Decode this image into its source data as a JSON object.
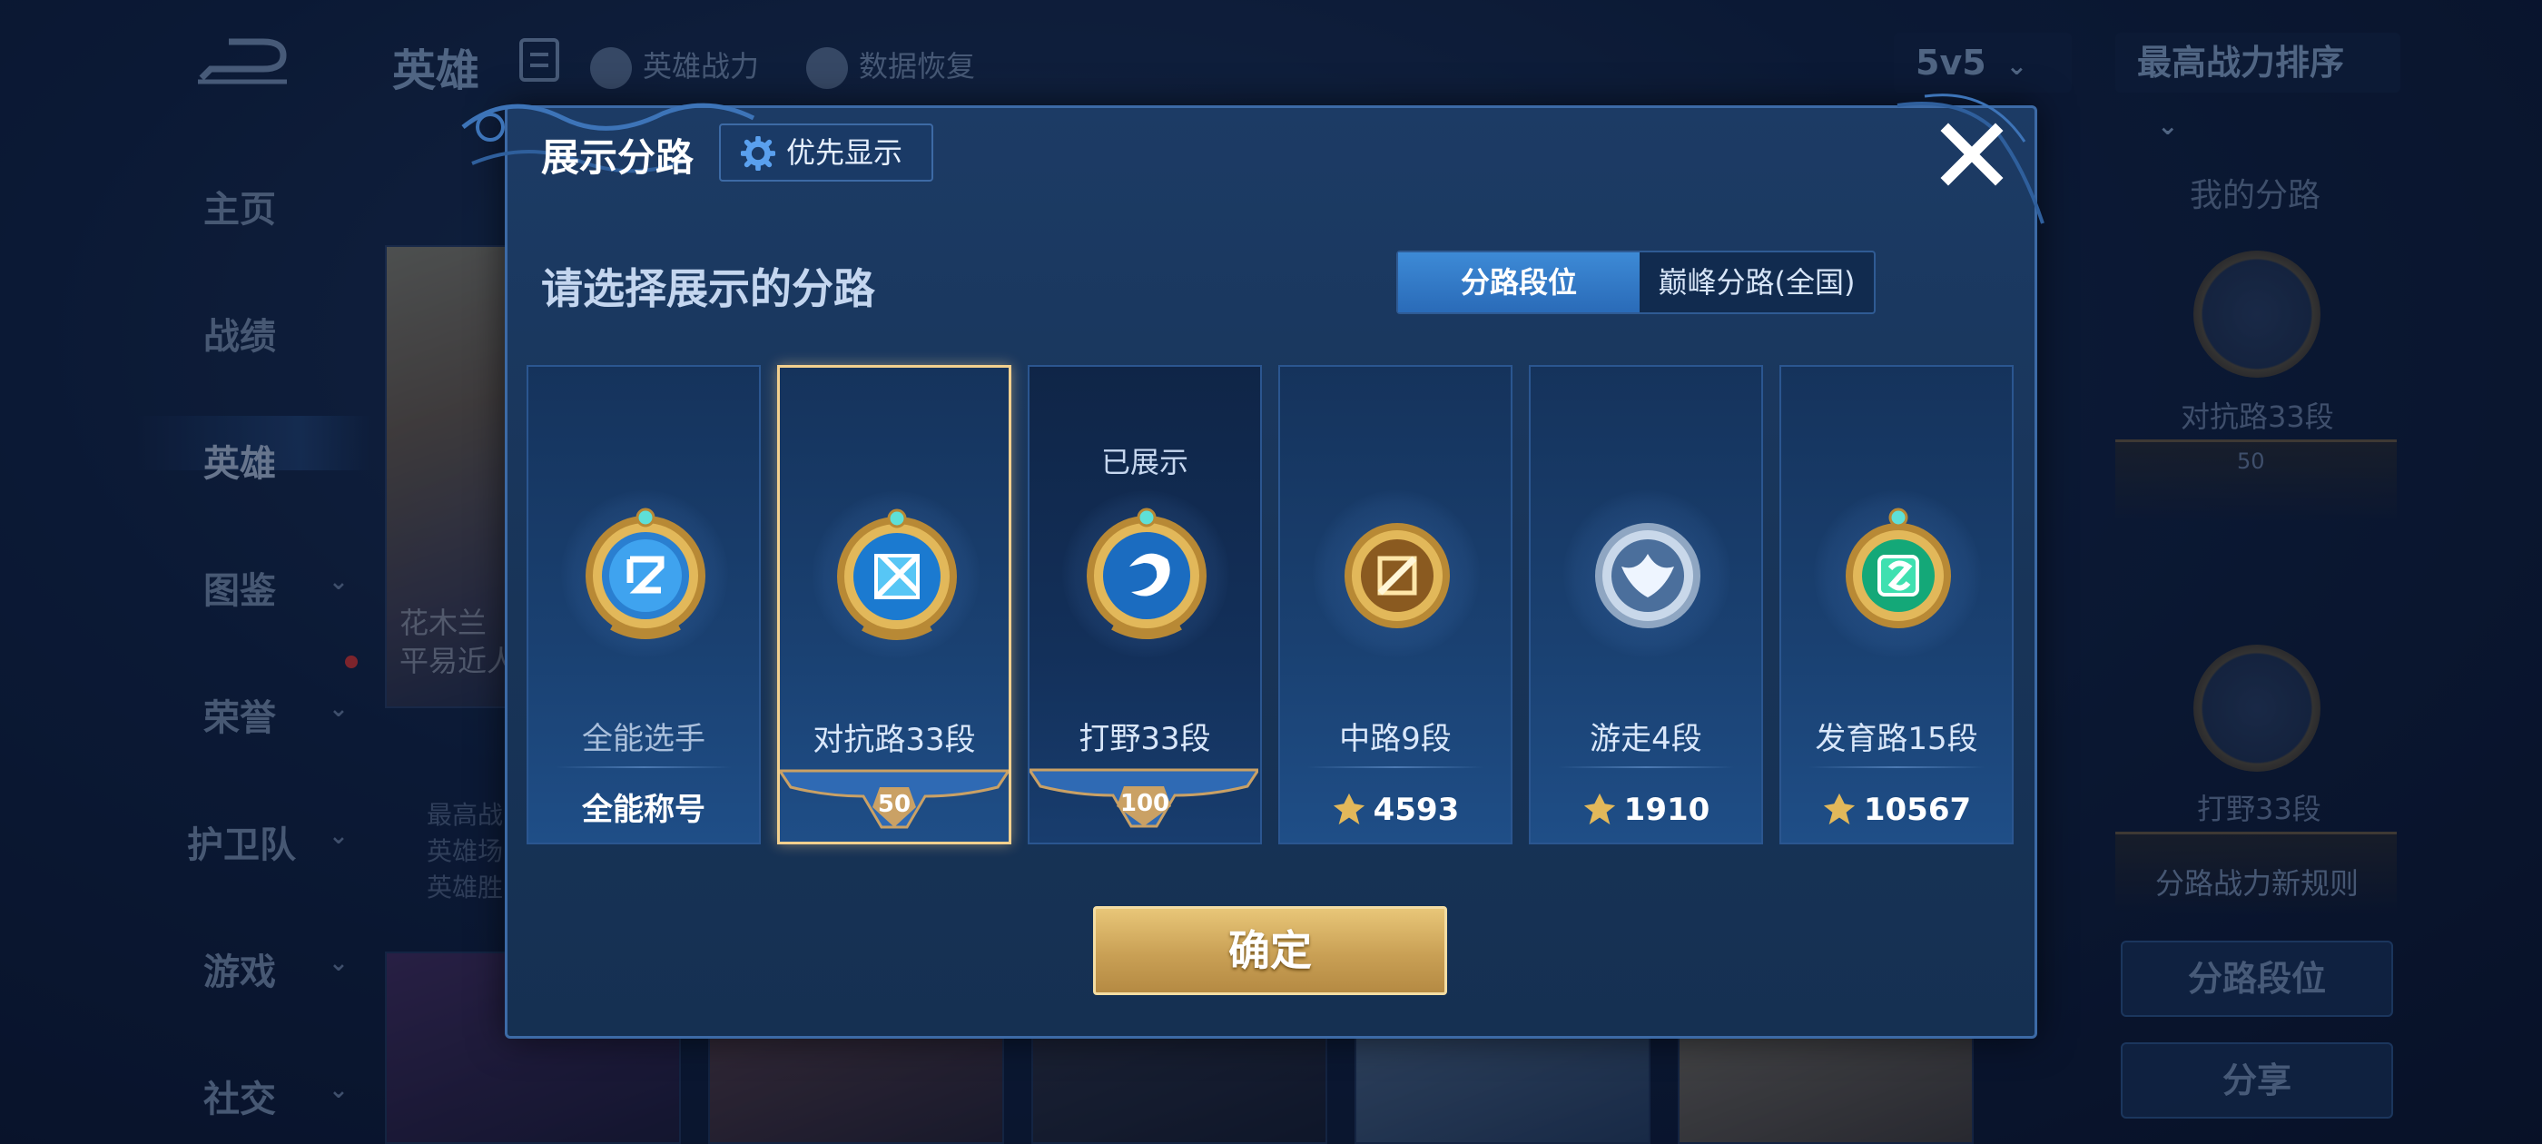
{
  "topbar": {
    "title": "英雄",
    "links": [
      "英雄战力",
      "数据恢复"
    ],
    "mode_select": "5v5",
    "sort_select": "最高战力排序"
  },
  "nav": [
    {
      "label": "主页",
      "has_chevron": false
    },
    {
      "label": "战绩",
      "has_chevron": false
    },
    {
      "label": "英雄",
      "has_chevron": false,
      "active": true
    },
    {
      "label": "图鉴",
      "has_chevron": true
    },
    {
      "label": "荣誉",
      "has_chevron": true
    },
    {
      "label": "护卫队",
      "has_chevron": true
    },
    {
      "label": "游戏",
      "has_chevron": true
    },
    {
      "label": "社交",
      "has_chevron": true
    }
  ],
  "background_card": {
    "name_line1": "花木兰",
    "name_line2": "平易近人",
    "stats": [
      "最高战",
      "英雄场",
      "英雄胜"
    ]
  },
  "right_panel": {
    "title": "我的分路",
    "lane1_label": "对抗路33段",
    "lane1_badge": "50",
    "lane2_label": "打野33段",
    "note": "分路战力新规则",
    "btn_rank": "分路段位",
    "btn_share": "分享"
  },
  "modal": {
    "title": "展示分路",
    "priority_button": "优先显示",
    "subtitle": "请选择展示的分路",
    "segment": {
      "option_a": "分路段位",
      "option_b": "巅峰分路(全国)",
      "selected": "option_a"
    },
    "lanes": [
      {
        "name": "全能选手",
        "foot": "全能称号",
        "foot_type": "text",
        "selected": false,
        "shown_label": ""
      },
      {
        "name": "对抗路33段",
        "foot": "50",
        "foot_type": "banner",
        "selected": true,
        "shown_label": ""
      },
      {
        "name": "打野33段",
        "foot": "100",
        "foot_type": "banner",
        "selected": false,
        "shown_label": "已展示"
      },
      {
        "name": "中路9段",
        "foot": "4593",
        "foot_type": "power",
        "selected": false,
        "shown_label": ""
      },
      {
        "name": "游走4段",
        "foot": "1910",
        "foot_type": "power",
        "selected": false,
        "shown_label": ""
      },
      {
        "name": "发育路15段",
        "foot": "10567",
        "foot_type": "power",
        "selected": false,
        "shown_label": ""
      }
    ],
    "confirm_button": "确定"
  },
  "icons": {
    "back": "back-arrow-icon",
    "gear": "gear-icon",
    "close": "close-icon",
    "power": "power-icon",
    "emblems": [
      "all-round-emblem-icon",
      "clash-lane-emblem-icon",
      "jungle-emblem-icon",
      "mid-lane-emblem-icon",
      "roam-emblem-icon",
      "farm-lane-emblem-icon"
    ]
  },
  "colors": {
    "accent_blue": "#2a6bb8",
    "gold": "#c9a055",
    "selected_border": "#f3d08e"
  }
}
